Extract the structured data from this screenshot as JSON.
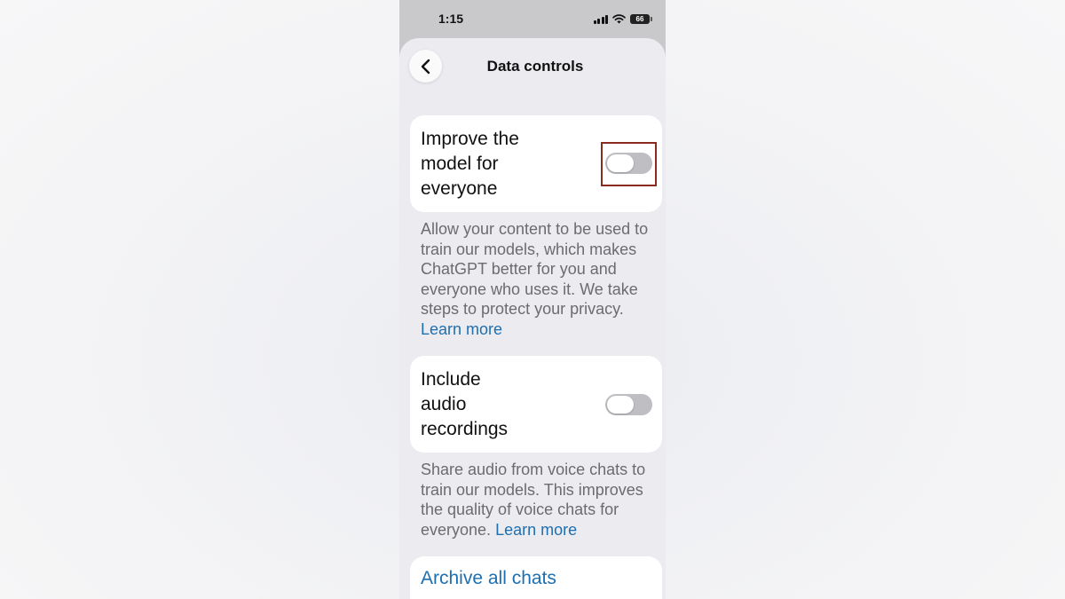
{
  "status_bar": {
    "time": "1:15",
    "battery": "66"
  },
  "header": {
    "title": "Data controls",
    "back_icon": "chevron-left-icon"
  },
  "settings": [
    {
      "title_lines": [
        "Improve the",
        "model for",
        "everyone"
      ],
      "toggle_state": "off",
      "description": "Allow your content to be used to train our models, which makes ChatGPT better for you and everyone who uses it. We take steps to protect your privacy.",
      "link": "Learn more"
    },
    {
      "title_lines": [
        "Include",
        "audio",
        "recordings"
      ],
      "toggle_state": "off",
      "description": "Share audio from voice chats to train our models. This improves the quality of voice chats for everyone.",
      "link": "Learn more"
    }
  ],
  "archive": {
    "label": "Archive all chats"
  },
  "colors": {
    "link": "#1e6fb0",
    "highlight_box": "#8b2a20",
    "toggle_off": "#bfbfc3"
  }
}
